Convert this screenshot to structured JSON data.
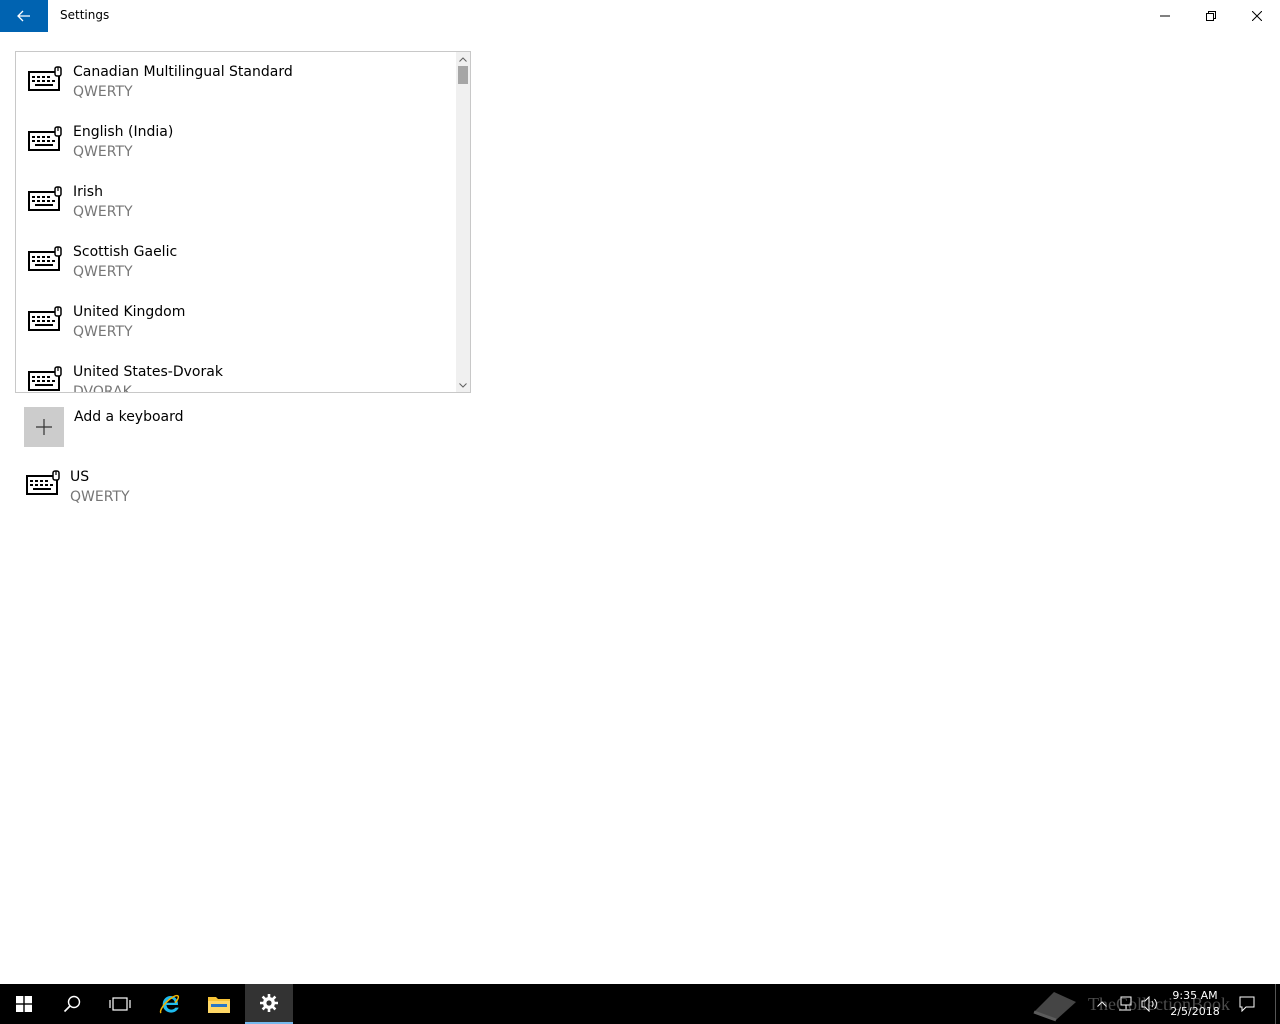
{
  "window": {
    "title": "Settings",
    "back_icon": "arrow-left-icon",
    "controls": [
      "minimize-icon",
      "restore-icon",
      "close-icon"
    ]
  },
  "keyboard_list": {
    "items": [
      {
        "name": "Canadian Multilingual Standard",
        "layout": "QWERTY"
      },
      {
        "name": "English (India)",
        "layout": "QWERTY"
      },
      {
        "name": "Irish",
        "layout": "QWERTY"
      },
      {
        "name": "Scottish Gaelic",
        "layout": "QWERTY"
      },
      {
        "name": "United Kingdom",
        "layout": "QWERTY"
      },
      {
        "name": "United States-Dvorak",
        "layout": "DVORAK"
      }
    ]
  },
  "add_keyboard": {
    "label": "Add a keyboard"
  },
  "installed_keyboard": {
    "name": "US",
    "layout": "QWERTY"
  },
  "taskbar": {
    "clock_time": "9:35 AM",
    "clock_date": "2/5/2018",
    "watermark": "TheCollectionBook"
  },
  "colors": {
    "accent": "#0063b1",
    "secondary_text": "#767676"
  }
}
